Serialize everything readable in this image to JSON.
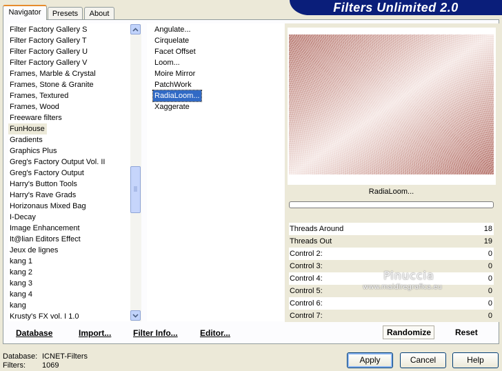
{
  "banner": {
    "title": "Filters Unlimited 2.0"
  },
  "tabs": [
    {
      "label": "Navigator"
    },
    {
      "label": "Presets"
    },
    {
      "label": "About"
    }
  ],
  "categories": [
    "Filter Factory Gallery S",
    "Filter Factory Gallery T",
    "Filter Factory Gallery U",
    "Filter Factory Gallery V",
    "Frames, Marble & Crystal",
    "Frames, Stone & Granite",
    "Frames, Textured",
    "Frames, Wood",
    "Freeware filters",
    "FunHouse",
    "Gradients",
    "Graphics Plus",
    "Greg's Factory Output Vol. II",
    "Greg's Factory Output",
    "Harry's Button Tools",
    "Harry's Rave Grads",
    "Horizonaus Mixed Bag",
    "I-Decay",
    "Image Enhancement",
    "It@lian Editors Effect",
    "Jeux de lignes",
    "kang 1",
    "kang 2",
    "kang 3",
    "kang 4",
    "kang",
    "Krusty's FX vol. I 1.0"
  ],
  "selected_category": "FunHouse",
  "filters": [
    "Angulate...",
    "Cirquelate",
    "Facet Offset",
    "Loom...",
    "Moire Mirror",
    "PatchWork",
    "RadiaLoom...",
    "Xaggerate"
  ],
  "selected_filter": "RadiaLoom...",
  "toolbar": {
    "database": "Database",
    "import": "Import...",
    "filter_info": "Filter Info...",
    "editor": "Editor..."
  },
  "preview": {
    "filter_name": "RadiaLoom...",
    "progress": 0
  },
  "params": [
    {
      "name": "Threads Around",
      "value": "18"
    },
    {
      "name": "Threads Out",
      "value": "19"
    },
    {
      "name": "Control 2:",
      "value": "0"
    },
    {
      "name": "Control 3:",
      "value": "0"
    },
    {
      "name": "Control 4:",
      "value": "0"
    },
    {
      "name": "Control 5:",
      "value": "0"
    },
    {
      "name": "Control 6:",
      "value": "0"
    },
    {
      "name": "Control 7:",
      "value": "0"
    }
  ],
  "watermark": {
    "name": "Pinuccia",
    "url": "www.maidiregrafica.eu"
  },
  "actions": {
    "randomize": "Randomize",
    "reset": "Reset"
  },
  "status": {
    "database_label": "Database:",
    "database_value": "ICNET-Filters",
    "filters_label": "Filters:",
    "filters_value": "1069"
  },
  "buttons": {
    "apply": "Apply",
    "cancel": "Cancel",
    "help": "Help"
  },
  "icons": {
    "scroll_up": "chevron-up-icon",
    "scroll_down": "chevron-down-icon"
  }
}
